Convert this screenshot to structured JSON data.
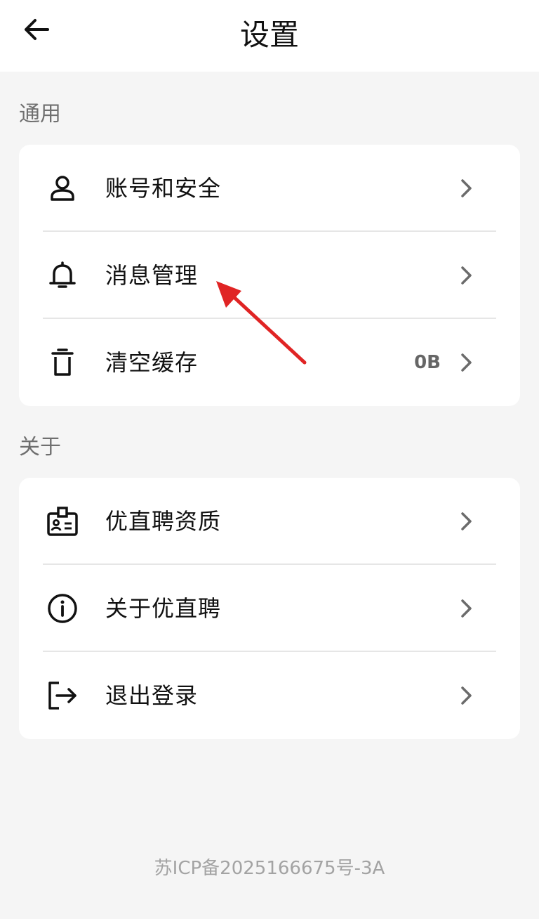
{
  "header": {
    "title": "设置",
    "back_icon": "arrow-left-icon"
  },
  "sections": [
    {
      "label": "通用",
      "items": [
        {
          "icon": "person-icon",
          "label": "账号和安全",
          "value": ""
        },
        {
          "icon": "bell-icon",
          "label": "消息管理",
          "value": ""
        },
        {
          "icon": "trash-icon",
          "label": "清空缓存",
          "value": "0B"
        }
      ]
    },
    {
      "label": "关于",
      "items": [
        {
          "icon": "id-badge-icon",
          "label": "优直聘资质",
          "value": ""
        },
        {
          "icon": "info-icon",
          "label": "关于优直聘",
          "value": ""
        },
        {
          "icon": "logout-icon",
          "label": "退出登录",
          "value": ""
        }
      ]
    }
  ],
  "footer": {
    "icp": "苏ICP备2025166675号-3A"
  },
  "colors": {
    "background": "#f5f5f5",
    "card": "#ffffff",
    "annotation_arrow": "#e02424"
  }
}
